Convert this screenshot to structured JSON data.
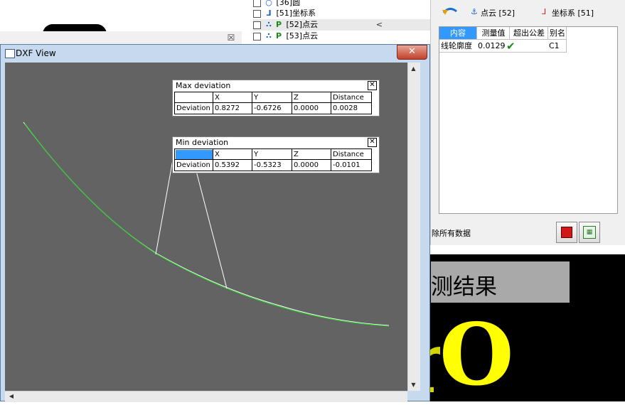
{
  "tree": {
    "items": [
      {
        "label": "[36]圆",
        "icon": "circle-icon"
      },
      {
        "label": "[51]坐标系",
        "icon": "coordinate-system-icon"
      },
      {
        "label": "[52]点云",
        "icon": "point-cloud-icon",
        "selected": true,
        "arrow": "<"
      },
      {
        "label": "[53]点云",
        "icon": "point-cloud-icon"
      }
    ]
  },
  "right_panel": {
    "tab1": "点云 [52]",
    "tab2": "坐标系 [51]",
    "table": {
      "headers": [
        "内容",
        "测量值",
        "超出公差",
        "别名"
      ],
      "row": {
        "content": "线轮廓度",
        "value": "0.0129",
        "status": "check-icon",
        "alias": "C1"
      }
    },
    "clear_label": "除所有数据",
    "buttons": [
      "red-cube-icon",
      "spreadsheet-export-icon"
    ]
  },
  "bottom_right": {
    "banner_text": "测结果",
    "big_letter": "O"
  },
  "dxf_window": {
    "title": "DXF View",
    "close_glyph": "✕"
  },
  "max_deviation": {
    "title": "Max deviation",
    "headers": [
      "",
      "X",
      "Y",
      "Z",
      "Distance"
    ],
    "row_label": "Deviation",
    "values": [
      "0.8272",
      "-0.6726",
      "0.0000",
      "0.0028"
    ]
  },
  "min_deviation": {
    "title": "Min deviation",
    "headers": [
      "",
      "X",
      "Y",
      "Z",
      "Distance"
    ],
    "row_label": "Deviation",
    "values": [
      "0.5392",
      "-0.5323",
      "0.0000",
      "-0.0101"
    ]
  },
  "colors": {
    "canvas": "#636363",
    "curve_measured": "#33cc33",
    "curve_nominal": "#ffffff",
    "selection": "#3399ff",
    "close_button": "#c2412b",
    "big_letter": "#ffff00"
  }
}
